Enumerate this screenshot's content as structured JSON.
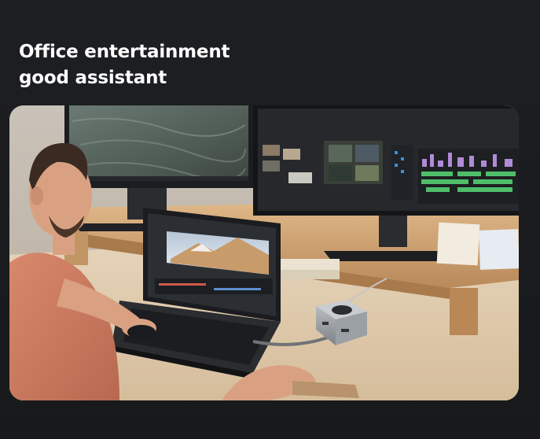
{
  "headline": {
    "line1": "Office entertainment",
    "line2": "good assistant"
  },
  "photo": {
    "icons": {
      "person": "person-figure",
      "monitor_left": "monitor-icon",
      "monitor_right": "monitor-icon",
      "laptop": "laptop-icon",
      "dock": "usb-hub-icon",
      "mouse": "mouse-icon"
    }
  }
}
